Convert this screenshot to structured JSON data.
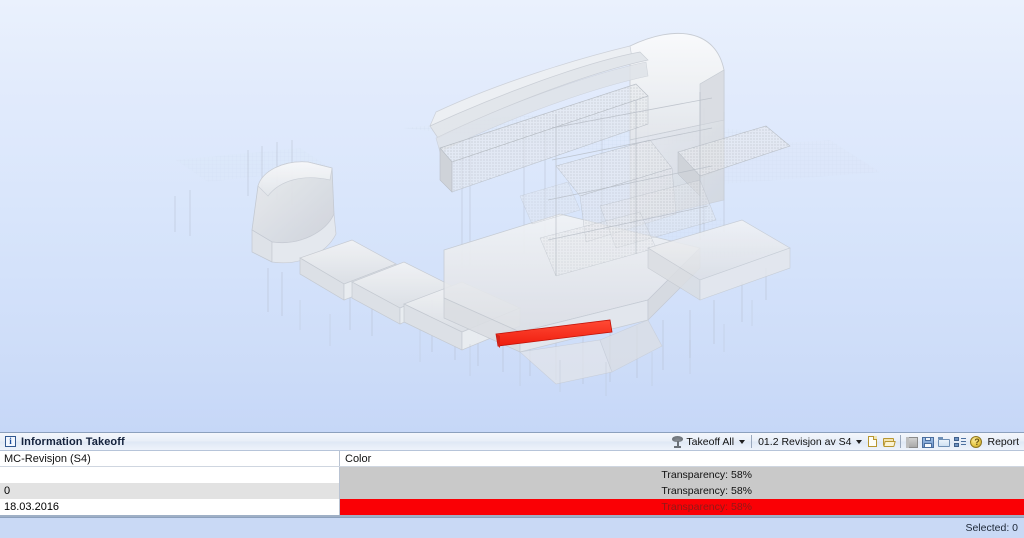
{
  "viewport": {
    "name": "3d-model-viewport",
    "description": "3D BIM building model, translucent white/gray volumes on light blue gradient background",
    "background_top": "#eaf1fd",
    "background_bottom": "#c6d7f7",
    "model_color": "#e8eaee",
    "highlight_color": "#fa2a20"
  },
  "panel": {
    "title": "Information Takeoff",
    "info_icon": "information-icon",
    "toolbar": {
      "takeoff_icon": "takeoff-icon",
      "takeoff_label": "Takeoff All",
      "revision_label": "01.2 Revisjon av S4",
      "icons": [
        "new-document-icon",
        "open-folder-icon",
        "slab-icon",
        "save-icon",
        "folder-icon",
        "properties-list-icon",
        "report-seal-icon"
      ],
      "report_label": "Report"
    }
  },
  "grid": {
    "columns": [
      "MC-Revisjon (S4)",
      "Color"
    ],
    "rows": [
      {
        "name": "",
        "color_text": "Transparency: 58%",
        "swatch": "#c9c9c9"
      },
      {
        "name": "0",
        "color_text": "Transparency: 58%",
        "swatch": "#c9c9c9"
      },
      {
        "name": "18.03.2016",
        "color_text": "Transparency: 58%",
        "swatch": "#fa0005"
      }
    ]
  },
  "statusbar": {
    "selected_label": "Selected: 0"
  }
}
